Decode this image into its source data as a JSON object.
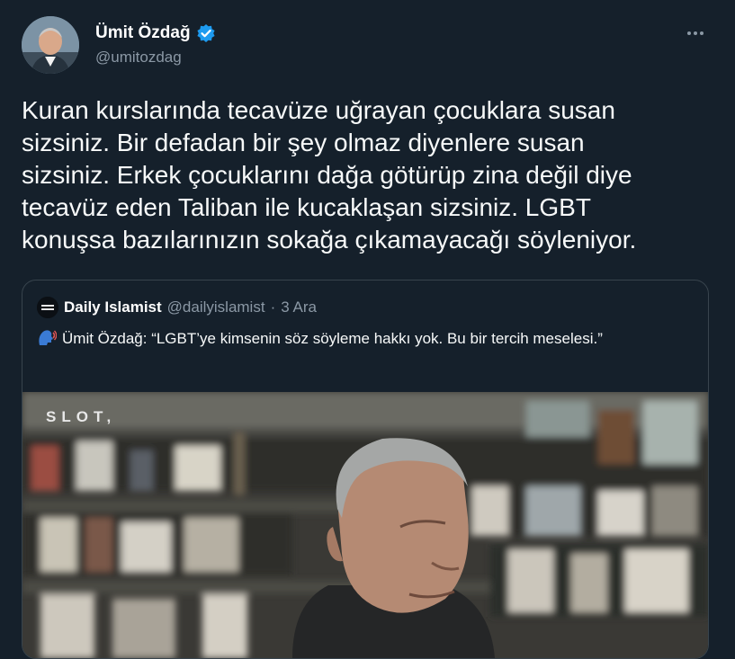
{
  "author": {
    "display_name": "Ümit Özdağ",
    "handle": "@umitozdag"
  },
  "tweet": {
    "text": "Kuran kurslarında tecavüze uğrayan çocuklara susan\nsizsiniz. Bir defadan bir şey olmaz diyenlere susan\nsizsiniz. Erkek çocuklarını dağa götürüp zina değil diye\ntecavüz eden Taliban ile kucaklaşan sizsiniz. LGBT\nkonuşsa bazılarınızın sokağa çıkamayacağı söyleniyor."
  },
  "quote": {
    "display_name": "Daily Islamist",
    "handle": "@dailyislamist",
    "separator": "·",
    "date": "3 Ara",
    "avatar_text": "DAILY ISLAMIST",
    "emoji_icon": "speaking-head-icon",
    "text": "Ümit Özdağ: “LGBT’ye kimsenin söz söyleme hakkı yok. Bu bir tercih meselesi.”",
    "media_watermark": "SLOT,"
  },
  "colors": {
    "background": "#15202b",
    "border": "#38444d",
    "muted": "#8b98a5",
    "verified": "#1d9bf0"
  }
}
